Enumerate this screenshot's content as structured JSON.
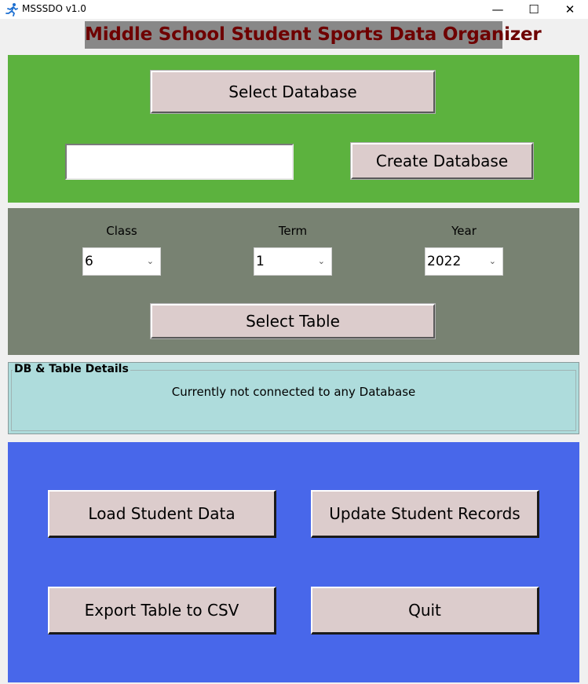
{
  "window": {
    "title": "MSSSDO v1.0",
    "icon": "running-figure-icon",
    "controls": {
      "minimize": "—",
      "maximize": "☐",
      "close": "✕"
    }
  },
  "header": {
    "title": "Middle School Student Sports Data Organizer"
  },
  "database": {
    "select_label": "Select Database",
    "name_value": "",
    "create_label": "Create Database"
  },
  "table_select": {
    "class_label": "Class",
    "class_value": "6",
    "term_label": "Term",
    "term_value": "1",
    "year_label": "Year",
    "year_value": "2022",
    "select_table_label": "Select Table"
  },
  "details": {
    "legend": "DB & Table Details",
    "status": "Currently not connected to any Database"
  },
  "actions": {
    "load_label": "Load Student Data",
    "update_label": "Update Student Records",
    "export_label": "Export Table to CSV",
    "quit_label": "Quit"
  },
  "colors": {
    "green_panel": "#5cb23e",
    "gray_panel": "#788272",
    "cyan_panel": "#aedcdc",
    "blue_panel": "#4867ea",
    "button": "#dccccc",
    "title_text": "#6e0000"
  }
}
